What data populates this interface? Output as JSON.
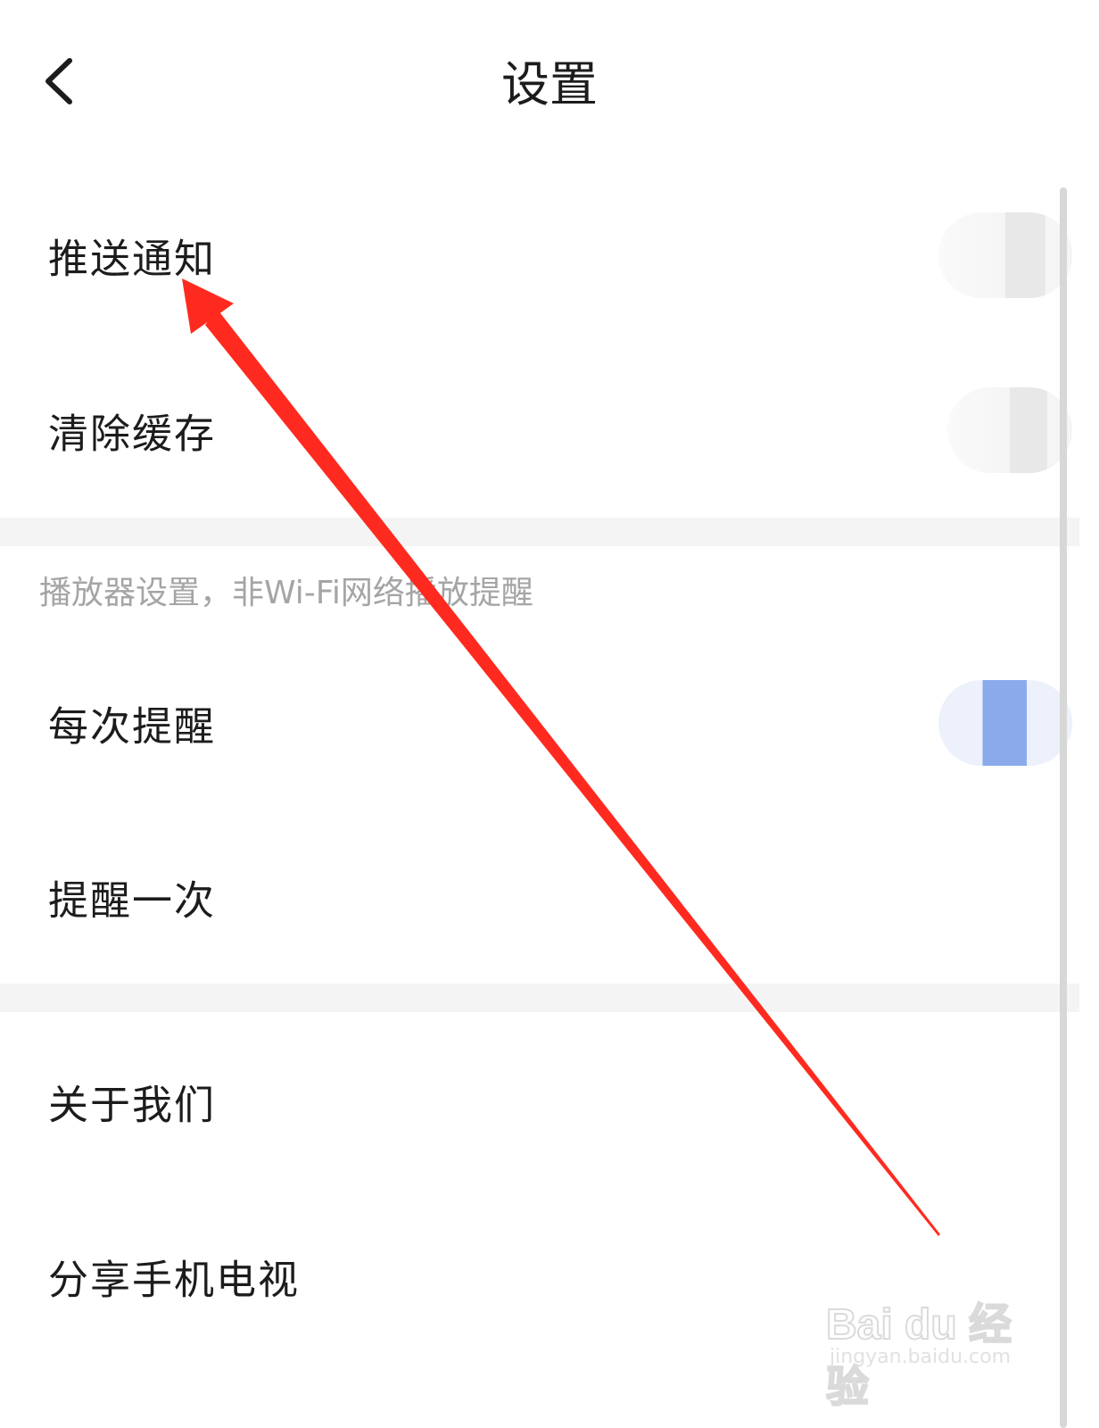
{
  "header": {
    "title": "设置",
    "back_icon": "chevron-left-icon"
  },
  "settings": {
    "push_notification": {
      "label": "推送通知",
      "toggle_state": "off"
    },
    "clear_cache": {
      "label": "清除缓存",
      "toggle_state": "off"
    }
  },
  "player_section": {
    "caption": "播放器设置，非Wi-Fi网络播放提醒",
    "remind_every_time": {
      "label": "每次提醒",
      "toggle_state": "on"
    },
    "remind_once": {
      "label": "提醒一次"
    }
  },
  "about_section": {
    "about_us": {
      "label": "关于我们"
    },
    "share_app": {
      "label": "分享手机电视"
    }
  },
  "annotation": {
    "arrow_color": "#ff2a1f",
    "arrow_points_to": "推送通知"
  },
  "watermark": {
    "logo": "Bai du 经验",
    "url": "jingyan.baidu.com"
  },
  "colors": {
    "toggle_on": "#8aaaeb",
    "divider": "#f4f4f5",
    "caption": "#a5a5a5"
  }
}
